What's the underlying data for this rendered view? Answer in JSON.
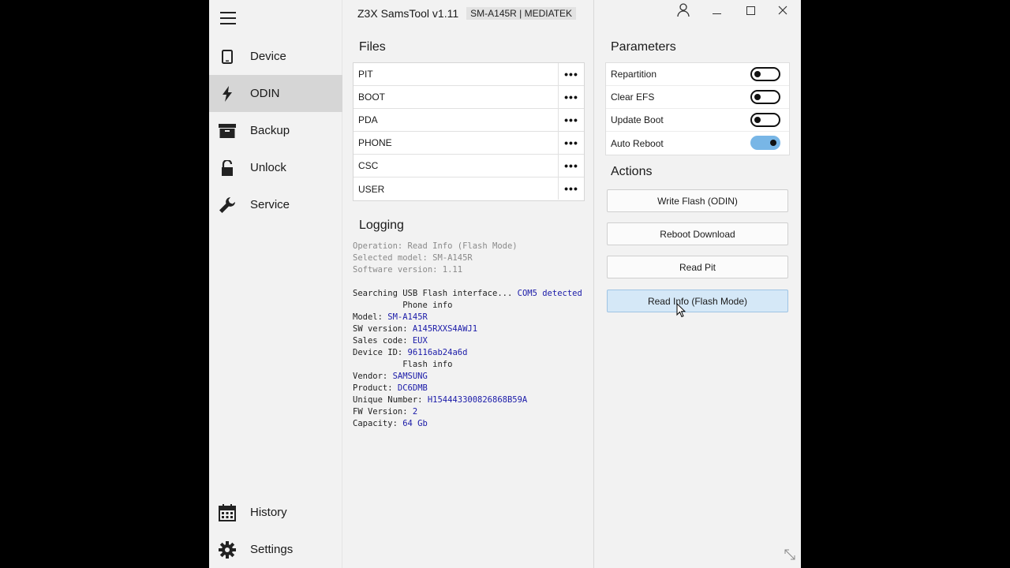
{
  "sidebar": {
    "items": [
      {
        "label": "Device",
        "icon": "tablet-icon"
      },
      {
        "label": "ODIN",
        "icon": "lightning-icon"
      },
      {
        "label": "Backup",
        "icon": "archive-box-icon"
      },
      {
        "label": "Unlock",
        "icon": "unlock-icon"
      },
      {
        "label": "Service",
        "icon": "wrench-icon"
      }
    ],
    "bottom_items": [
      {
        "label": "History",
        "icon": "calendar-icon"
      },
      {
        "label": "Settings",
        "icon": "gear-icon"
      }
    ],
    "active": "ODIN"
  },
  "header": {
    "title": "Z3X SamsTool v1.11",
    "badge": "SM-A145R | MEDIATEK"
  },
  "files": {
    "heading": "Files",
    "rows": [
      "PIT",
      "BOOT",
      "PDA",
      "PHONE",
      "CSC",
      "USER"
    ],
    "browse_label": "•••"
  },
  "logging": {
    "heading": "Logging",
    "lines": [
      {
        "parts": [
          {
            "t": "Operation: Read Info (Flash Mode)",
            "c": "gray"
          }
        ]
      },
      {
        "parts": [
          {
            "t": "Selected model: SM-A145R",
            "c": "gray"
          }
        ]
      },
      {
        "parts": [
          {
            "t": "Software version: 1.11",
            "c": "gray"
          }
        ]
      },
      {
        "parts": [
          {
            "t": "",
            "c": ""
          }
        ]
      },
      {
        "parts": [
          {
            "t": "Searching USB Flash interface... ",
            "c": ""
          },
          {
            "t": "COM5 detected",
            "c": "blue"
          }
        ]
      },
      {
        "parts": [
          {
            "t": "          Phone info",
            "c": ""
          }
        ]
      },
      {
        "parts": [
          {
            "t": "Model: ",
            "c": ""
          },
          {
            "t": "SM-A145R",
            "c": "blue"
          }
        ]
      },
      {
        "parts": [
          {
            "t": "SW version: ",
            "c": ""
          },
          {
            "t": "A145RXXS4AWJ1",
            "c": "blue"
          }
        ]
      },
      {
        "parts": [
          {
            "t": "Sales code: ",
            "c": ""
          },
          {
            "t": "EUX",
            "c": "blue"
          }
        ]
      },
      {
        "parts": [
          {
            "t": "Device ID: ",
            "c": ""
          },
          {
            "t": "96116ab24a6d",
            "c": "blue"
          }
        ]
      },
      {
        "parts": [
          {
            "t": "          Flash info",
            "c": ""
          }
        ]
      },
      {
        "parts": [
          {
            "t": "Vendor: ",
            "c": ""
          },
          {
            "t": "SAMSUNG",
            "c": "blue"
          }
        ]
      },
      {
        "parts": [
          {
            "t": "Product: ",
            "c": ""
          },
          {
            "t": "DC6DMB",
            "c": "blue"
          }
        ]
      },
      {
        "parts": [
          {
            "t": "Unique Number: ",
            "c": ""
          },
          {
            "t": "H154443300826868B59A",
            "c": "blue"
          }
        ]
      },
      {
        "parts": [
          {
            "t": "FW Version: ",
            "c": ""
          },
          {
            "t": "2",
            "c": "blue"
          }
        ]
      },
      {
        "parts": [
          {
            "t": "Capacity: ",
            "c": ""
          },
          {
            "t": "64 Gb",
            "c": "blue"
          }
        ]
      }
    ]
  },
  "parameters": {
    "heading": "Parameters",
    "items": [
      {
        "label": "Repartition",
        "on": false
      },
      {
        "label": "Clear EFS",
        "on": false
      },
      {
        "label": "Update Boot",
        "on": false
      },
      {
        "label": "Auto Reboot",
        "on": true
      }
    ]
  },
  "actions": {
    "heading": "Actions",
    "buttons": [
      "Write Flash (ODIN)",
      "Reboot Download",
      "Read Pit",
      "Read Info (Flash Mode)"
    ],
    "hovered": 3
  },
  "colors": {
    "toggle_on": "#78b6e6",
    "active_nav": "#d6d6d6",
    "log_value": "#1a1aa8",
    "hover_button": "#d5e8f7"
  }
}
